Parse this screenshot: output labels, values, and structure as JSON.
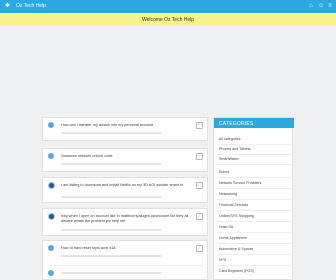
{
  "header": {
    "brand": "Oz Tech Help",
    "icons": [
      "home-icon",
      "user-icon",
      "menu-icon"
    ],
    "accent": "#2aa8e0"
  },
  "banner": {
    "text": "Welcome Oz Tech Help",
    "bg": "#f8f28a"
  },
  "questions": [
    {
      "title": "How can I transfer my aussie into my personal account"
    },
    {
      "title": "Vodacom network unlock code"
    },
    {
      "title": "I am failing to download and install Netflix on my 3D AOI sinister smart tv"
    },
    {
      "title": "why when i open on account like in mattfoxrhyalugen.opurlocsier.biz they all dislose whats the problem plz help me"
    },
    {
      "title": "How to hard reset stylo acre x18"
    }
  ],
  "sidebar": {
    "header": "CATEGORIES",
    "items": [
      "All categories",
      "Phones and Tablets",
      "SmartWatch",
      "Elders",
      "Network Service Providers",
      "Networking",
      "Financial Services",
      "Online/SYS Shopping",
      "Hotel SA",
      "Home Appliances",
      "Automotive & Spaces",
      "VPS",
      "Card Registers (POS)"
    ]
  }
}
